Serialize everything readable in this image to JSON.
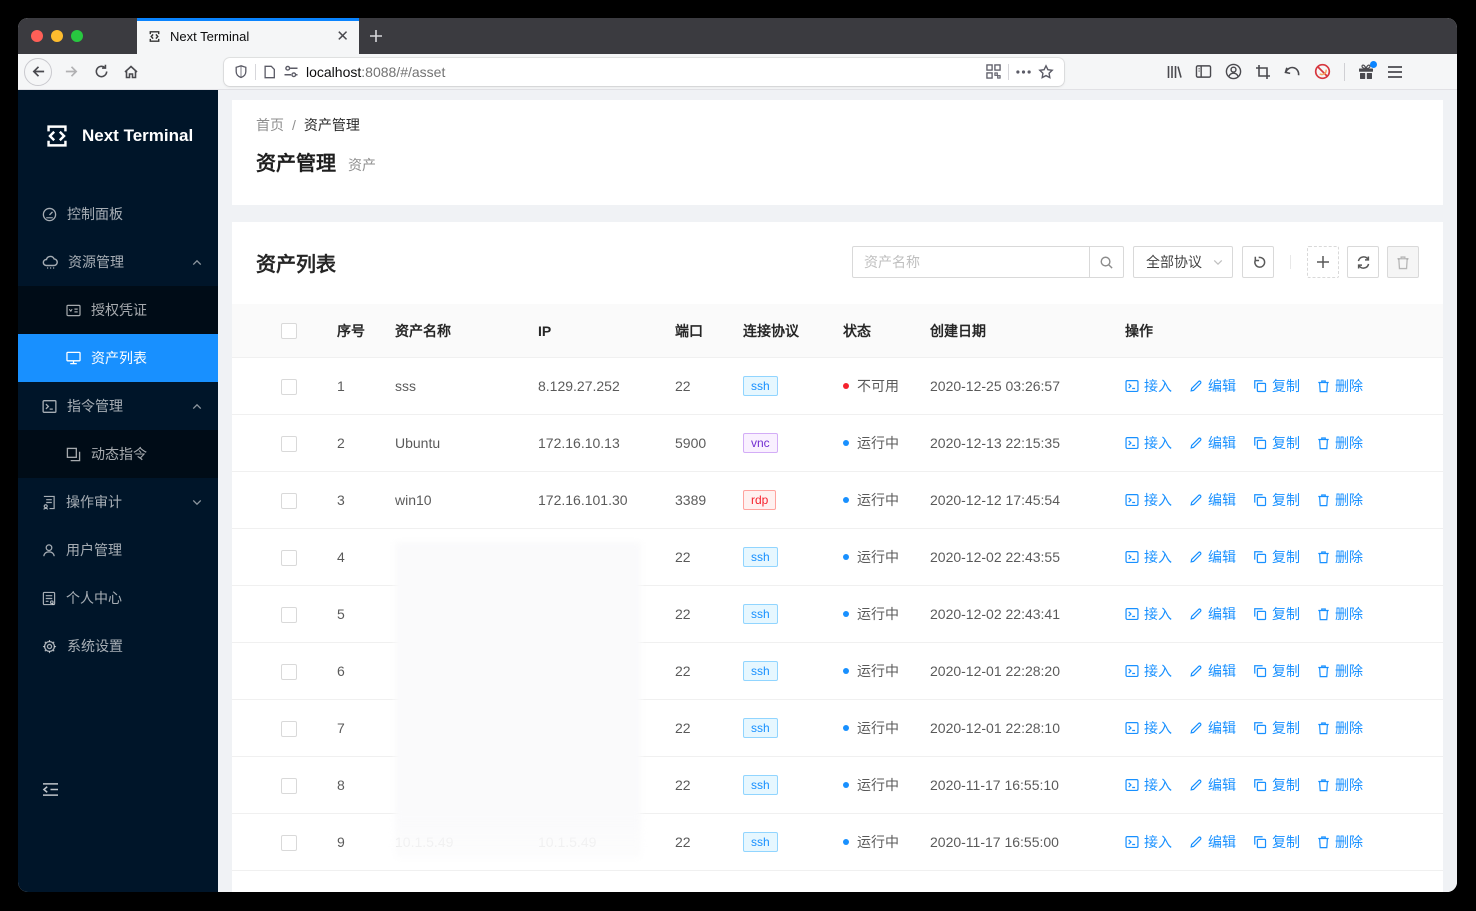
{
  "browser": {
    "tab_title": "Next Terminal",
    "url_host": "localhost",
    "url_rest": ":8088/#/asset"
  },
  "sidebar": {
    "brand": "Next Terminal",
    "items": [
      {
        "label": "控制面板"
      },
      {
        "label": "资源管理",
        "expanded": true
      },
      {
        "label": "授权凭证"
      },
      {
        "label": "资产列表",
        "active": true
      },
      {
        "label": "指令管理",
        "expanded": true
      },
      {
        "label": "动态指令"
      },
      {
        "label": "操作审计",
        "expanded": false
      },
      {
        "label": "用户管理"
      },
      {
        "label": "个人中心"
      },
      {
        "label": "系统设置"
      }
    ]
  },
  "page": {
    "breadcrumb": [
      "首页",
      "资产管理"
    ],
    "breadcrumb_separator": "/",
    "title": "资产管理",
    "subtitle": "资产"
  },
  "card": {
    "title": "资产列表",
    "search_placeholder": "资产名称",
    "protocol_filter": "全部协议"
  },
  "table": {
    "columns": [
      "序号",
      "资产名称",
      "IP",
      "端口",
      "连接协议",
      "状态",
      "创建日期",
      "操作"
    ],
    "actions": [
      "接入",
      "编辑",
      "复制",
      "删除"
    ],
    "rows": [
      {
        "no": "1",
        "name": "sss",
        "ip": "8.129.27.252",
        "port": "22",
        "protocol": "ssh",
        "status": "不可用",
        "status_type": "error",
        "date": "2020-12-25 03:26:57",
        "redacted": false
      },
      {
        "no": "2",
        "name": "Ubuntu",
        "ip": "172.16.10.13",
        "port": "5900",
        "protocol": "vnc",
        "status": "运行中",
        "status_type": "running",
        "date": "2020-12-13 22:15:35",
        "redacted": false
      },
      {
        "no": "3",
        "name": "win10",
        "ip": "172.16.101.30",
        "port": "3389",
        "protocol": "rdp",
        "status": "运行中",
        "status_type": "running",
        "date": "2020-12-12 17:45:54",
        "redacted": false
      },
      {
        "no": "4",
        "name": "",
        "ip": "",
        "port": "22",
        "protocol": "ssh",
        "status": "运行中",
        "status_type": "running",
        "date": "2020-12-02 22:43:55",
        "redacted": true
      },
      {
        "no": "5",
        "name": "",
        "ip": "",
        "port": "22",
        "protocol": "ssh",
        "status": "运行中",
        "status_type": "running",
        "date": "2020-12-02 22:43:41",
        "redacted": true
      },
      {
        "no": "6",
        "name": "",
        "ip": "",
        "port": "22",
        "protocol": "ssh",
        "status": "运行中",
        "status_type": "running",
        "date": "2020-12-01 22:28:20",
        "redacted": true
      },
      {
        "no": "7",
        "name": "",
        "ip": "",
        "port": "22",
        "protocol": "ssh",
        "status": "运行中",
        "status_type": "running",
        "date": "2020-12-01 22:28:10",
        "redacted": true
      },
      {
        "no": "8",
        "name": "",
        "ip": "",
        "port": "22",
        "protocol": "ssh",
        "status": "运行中",
        "status_type": "running",
        "date": "2020-11-17 16:55:10",
        "redacted": true
      },
      {
        "no": "9",
        "name": "10.1.5.49",
        "ip": "10.1.5.49",
        "port": "22",
        "protocol": "ssh",
        "status": "运行中",
        "status_type": "running",
        "date": "2020-11-17 16:55:00",
        "redacted": true
      }
    ]
  },
  "colors": {
    "accent": "#1890ff",
    "sidebar_bg": "#001529",
    "sidebar_submenu_bg": "#000c17",
    "status_error": "#f5222d",
    "status_running": "#1890ff",
    "tag_ssh": "#1890ff",
    "tag_vnc": "#722ed1",
    "tag_rdp": "#f5222d",
    "tab_accent": "#0a84ff"
  }
}
